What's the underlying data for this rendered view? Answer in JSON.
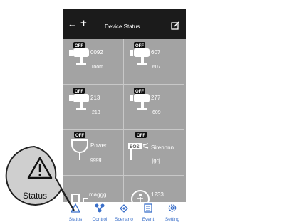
{
  "header": {
    "title": "Device Status"
  },
  "devices": [
    {
      "name": "0092",
      "room": "room",
      "status": "OFF"
    },
    {
      "name": "607",
      "room": "607",
      "status": "OFF"
    },
    {
      "name": "213",
      "room": "213",
      "status": "OFF"
    },
    {
      "name": "277",
      "room": "609",
      "status": "OFF"
    },
    {
      "name": "Power",
      "room": "gggg",
      "status": "OFF"
    },
    {
      "name": "Sirennnn",
      "room": "jgcj",
      "status": "OFF",
      "badge": "SOS"
    },
    {
      "name": "maggg",
      "room": "",
      "status": ""
    },
    {
      "name": "1233",
      "room": "",
      "status": ""
    }
  ],
  "tabs": [
    {
      "label": "Status"
    },
    {
      "label": "Control"
    },
    {
      "label": "Scenario"
    },
    {
      "label": "Event"
    },
    {
      "label": "Setting"
    }
  ],
  "callout": {
    "label": "Status"
  },
  "colors": {
    "topbar": "#1b1b1b",
    "grid": "#a3a3a3",
    "tab_accent": "#3a6fc9"
  }
}
